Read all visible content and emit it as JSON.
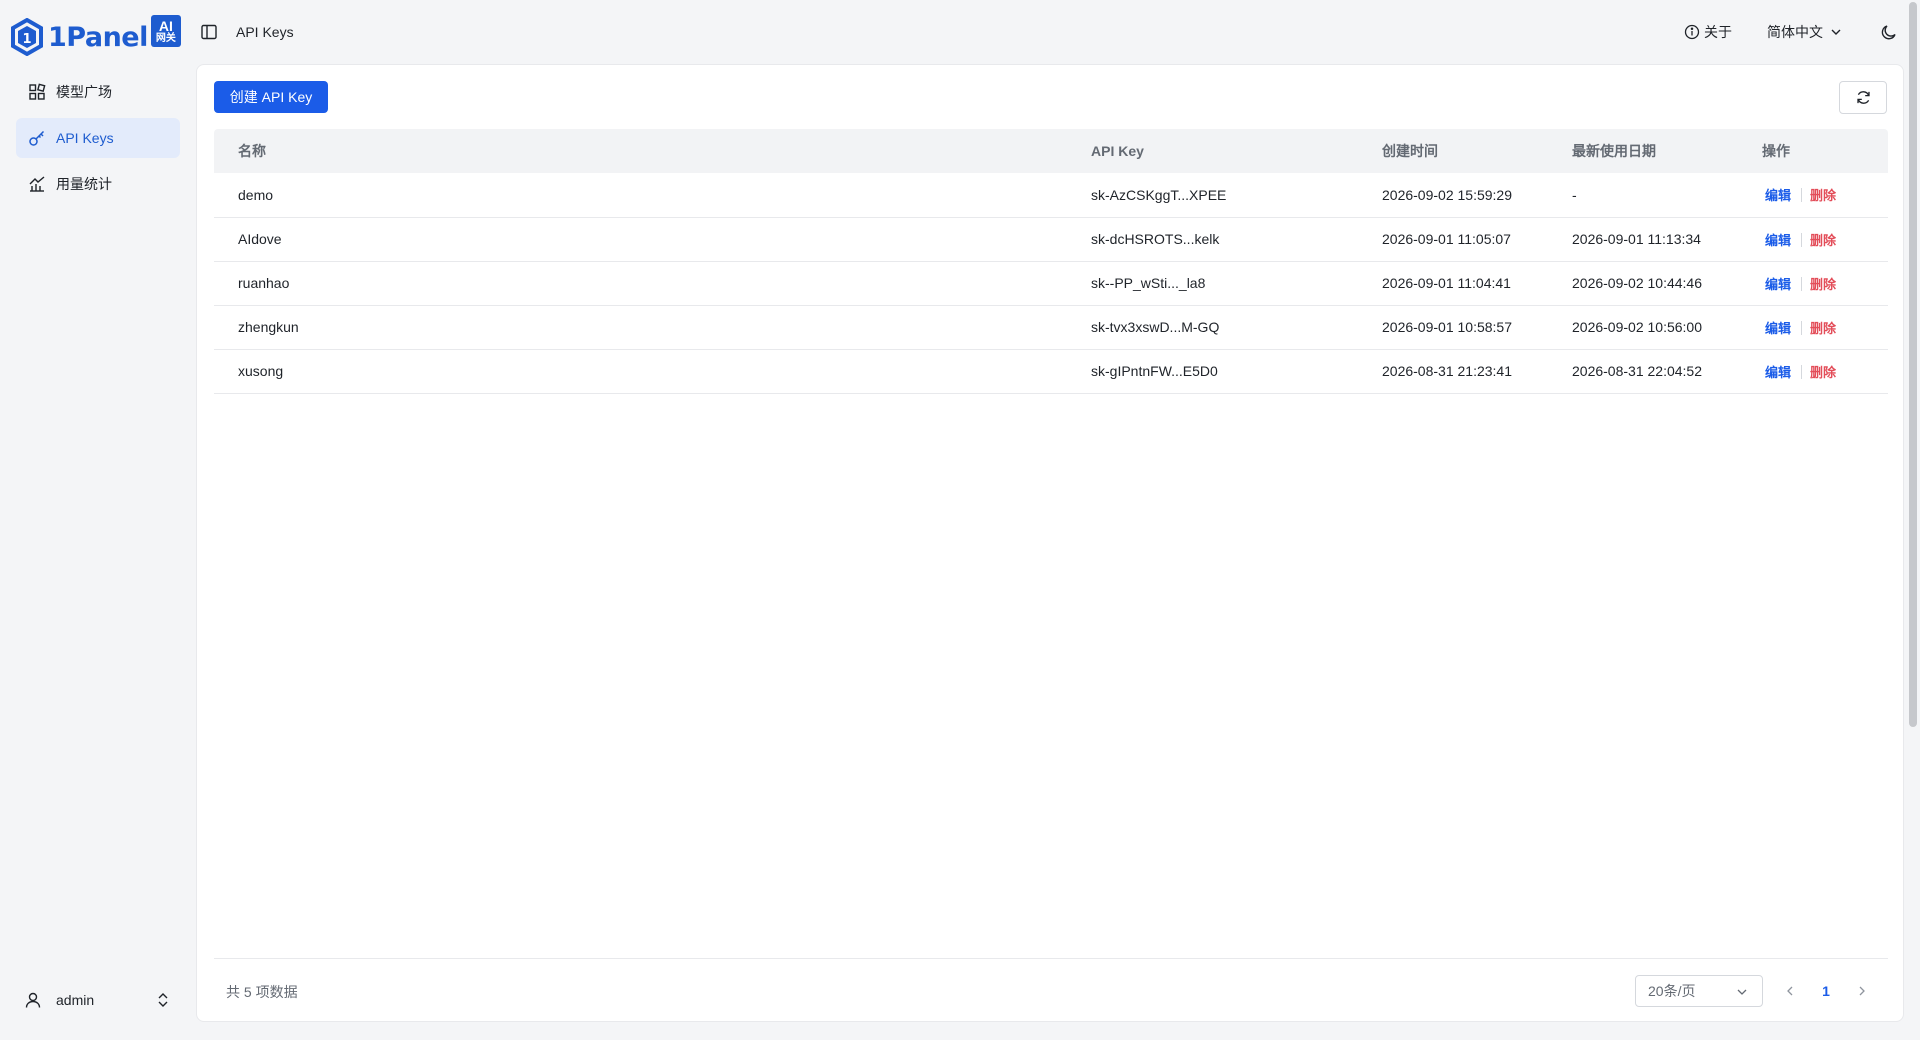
{
  "app": {
    "logo_text": "1Panel",
    "logo_badge_top": "AI",
    "logo_badge_bottom": "网关"
  },
  "sidebar": {
    "items": [
      {
        "label": "模型广场",
        "icon": "grid-icon"
      },
      {
        "label": "API Keys",
        "icon": "key-icon",
        "active": true
      },
      {
        "label": "用量统计",
        "icon": "chart-icon"
      }
    ],
    "user": {
      "name": "admin"
    }
  },
  "header": {
    "title": "API Keys",
    "about": "关于",
    "language": "简体中文"
  },
  "toolbar": {
    "create_label": "创建 API Key"
  },
  "table": {
    "columns": [
      "名称",
      "API Key",
      "创建时间",
      "最新使用日期",
      "操作"
    ],
    "edit_label": "编辑",
    "delete_label": "删除",
    "rows": [
      {
        "name": "demo",
        "key": "sk-AzCSKggT...XPEE",
        "created": "2026-09-02 15:59:29",
        "last_used": "-"
      },
      {
        "name": "AIdove",
        "key": "sk-dcHSROTS...kelk",
        "created": "2026-09-01 11:05:07",
        "last_used": "2026-09-01 11:13:34"
      },
      {
        "name": "ruanhao",
        "key": "sk--PP_wSti..._la8",
        "created": "2026-09-01 11:04:41",
        "last_used": "2026-09-02 10:44:46"
      },
      {
        "name": "zhengkun",
        "key": "sk-tvx3xswD...M-GQ",
        "created": "2026-09-01 10:58:57",
        "last_used": "2026-09-02 10:56:00"
      },
      {
        "name": "xusong",
        "key": "sk-gIPntnFW...E5D0",
        "created": "2026-08-31 21:23:41",
        "last_used": "2026-08-31 22:04:52"
      }
    ]
  },
  "pagination": {
    "total_text": "共 5 项数据",
    "page_size": "20条/页",
    "current_page": "1"
  },
  "colors": {
    "primary": "#1b5ce8",
    "danger": "#e34d59",
    "active_bg": "#e3ebfb"
  }
}
